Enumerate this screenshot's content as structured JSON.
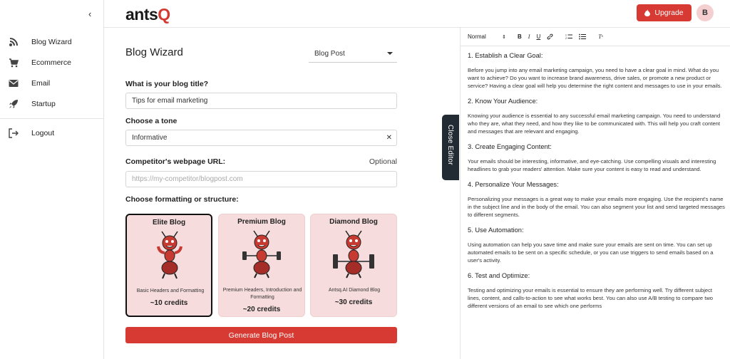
{
  "logo": {
    "text_main": "ants",
    "text_accent": "Q"
  },
  "header": {
    "upgrade_label": "Upgrade",
    "avatar_initial": "B"
  },
  "sidebar": {
    "collapse_glyph": "‹",
    "items": [
      {
        "label": "Blog Wizard",
        "icon": "rss-icon"
      },
      {
        "label": "Ecommerce",
        "icon": "cart-icon"
      },
      {
        "label": "Email",
        "icon": "envelope-icon"
      },
      {
        "label": "Startup",
        "icon": "rocket-icon"
      }
    ],
    "logout_label": "Logout"
  },
  "wizard": {
    "title": "Blog Wizard",
    "type_select": "Blog Post",
    "title_label": "What is your blog title?",
    "title_value": "Tips for email marketing",
    "tone_label": "Choose a tone",
    "tone_value": "Informative",
    "url_label": "Competitor's webpage URL:",
    "url_optional": "Optional",
    "url_placeholder": "https://my-competitor/blogpost.com",
    "format_label": "Choose formatting or structure:",
    "cards": [
      {
        "title": "Elite Blog",
        "desc": "Basic Headers and Formatting",
        "credits": "~10 credits"
      },
      {
        "title": "Premium Blog",
        "desc": "Premium Headers, Introduction and Formatting",
        "credits": "~20 credits"
      },
      {
        "title": "Diamond Blog",
        "desc": "Antsq.AI Diamond Blog",
        "credits": "~30 credits"
      }
    ],
    "generate_label": "Generate Blog Post"
  },
  "close_editor_label": "Close Editor",
  "editor": {
    "toolbar": {
      "format_select": "Normal",
      "buttons": [
        "bold-button",
        "italic-button",
        "underline-button",
        "link-button",
        "ordered-list-button",
        "bullet-list-button",
        "clear-format-button"
      ]
    },
    "sections": [
      {
        "heading": "1. Establish a Clear Goal:",
        "body": "Before you jump into any email marketing campaign, you need to have a clear goal in mind. What do you want to achieve? Do you want to increase brand awareness, drive sales, or promote a new product or service? Having a clear goal will help you determine the right content and messages to use in your emails."
      },
      {
        "heading": "2. Know Your Audience:",
        "body": "Knowing your audience is essential to any successful email marketing campaign. You need to understand who they are, what they need, and how they like to be communicated with. This will help you craft content and messages that are relevant and engaging."
      },
      {
        "heading": "3. Create Engaging Content:",
        "body": "Your emails should be interesting, informative, and eye-catching. Use compelling visuals and interesting headlines to grab your readers' attention. Make sure your content is easy to read and understand."
      },
      {
        "heading": "4. Personalize Your Messages:",
        "body": "Personalizing your messages is a great way to make your emails more engaging. Use the recipient's name in the subject line and in the body of the email. You can also segment your list and send targeted messages to different segments."
      },
      {
        "heading": "5. Use Automation:",
        "body": "Using automation can help you save time and make sure your emails are sent on time. You can set up automated emails to be sent on a specific schedule, or you can use triggers to send emails based on a user's activity."
      },
      {
        "heading": "6. Test and Optimize:",
        "body": "Testing and optimizing your emails is essential to ensure they are performing well. Try different subject lines, content, and calls-to-action to see what works best. You can also use A/B testing to compare two different versions of an email to see which one performs"
      }
    ]
  },
  "colors": {
    "accent": "#d63a33",
    "card_bg": "#f6dcdc",
    "close_editor_bg": "#222a33",
    "avatar_bg": "#f5cfcf"
  }
}
